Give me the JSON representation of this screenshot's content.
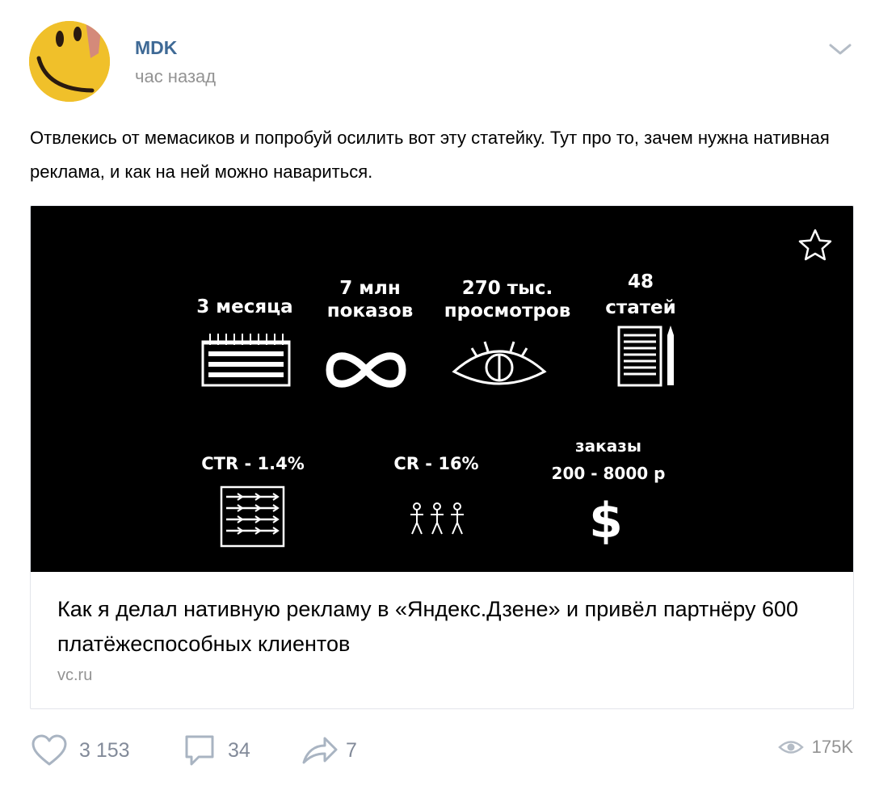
{
  "post": {
    "author": "MDK",
    "time": "час назад",
    "text": "Отвлекись от мемасиков и попробуй осилить вот эту статейку. Тут про то, зачем нужна нативная реклама, и как на ней можно навариться."
  },
  "card": {
    "image": {
      "stat_months": "3 месяца",
      "stat_shows_1": "7 млн",
      "stat_shows_2": "показов",
      "stat_views_1": "270 тыс.",
      "stat_views_2": "просмотров",
      "stat_articles_1": "48",
      "stat_articles_2": "статей",
      "stat_ctr": "CTR - 1.4%",
      "stat_cr": "CR - 16%",
      "stat_orders_1": "заказы",
      "stat_orders_2": "200 - 8000 р"
    },
    "title": "Как я делал нативную рекламу в «Яндекс.Дзене» и привёл партнёру 600 платёжеспособных клиентов",
    "domain": "vc.ru"
  },
  "actions": {
    "likes": "3 153",
    "comments": "34",
    "shares": "7",
    "views": "175K"
  },
  "icons": {
    "more": "chevron-down-icon",
    "bookmark": "star-icon",
    "like": "heart-icon",
    "comment": "comment-icon",
    "share": "share-arrow-icon",
    "views": "eye-icon"
  },
  "colors": {
    "author": "#3f6a96",
    "muted": "#939393",
    "action": "#828a99",
    "card_border": "#e2e5ea"
  }
}
